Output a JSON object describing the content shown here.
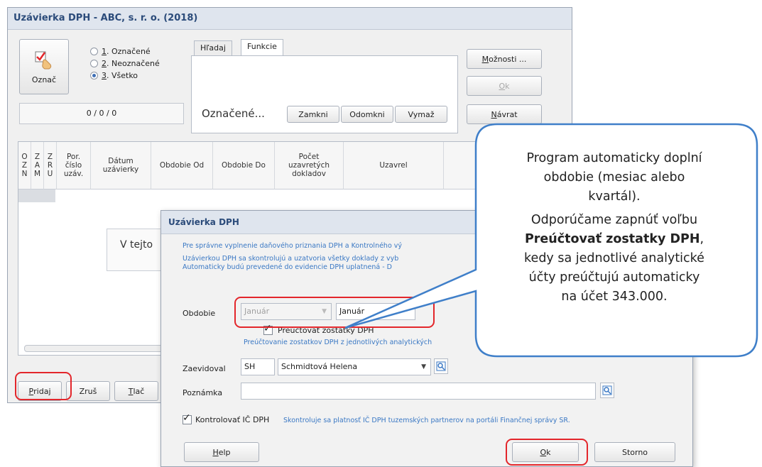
{
  "main": {
    "title": "Uzávierka DPH - ABC, s. r. o. (2018)",
    "mark_button": "Označ",
    "radios": [
      {
        "num": "1",
        "label": ". Označené"
      },
      {
        "num": "2",
        "label": ". Neoznačené"
      },
      {
        "num": "3",
        "label": ". Všetko"
      }
    ],
    "counter": "0 / 0 / 0",
    "tabs": [
      "Hľadaj",
      "Funkcie"
    ],
    "marked_label": "Označené...",
    "func_buttons": [
      "Zamkni",
      "Odomkni",
      "Vymaž"
    ],
    "side_buttons": {
      "options_u": "M",
      "options_rest": "ožnosti ...",
      "ok_u": "O",
      "ok_rest": "k",
      "return_u": "N",
      "return_rest": "ávrat"
    },
    "columns": [
      "O\nZ\nN",
      "Z\nA\nM",
      "Z\nR\nU",
      "Por.\nčíslo\nuzáv.",
      "Dátum\nuzávierky",
      "Obdobie Od",
      "Obdobie Do",
      "Počet\nuzavretých\ndokladov",
      "Uzavrel"
    ],
    "empty_text": "V tejto",
    "bottom_buttons": {
      "add_u": "P",
      "add_rest": "ridaj",
      "cancel_u": "",
      "cancel_rest": "Zruš",
      "print_u": "T",
      "print_rest": "lač"
    }
  },
  "dialog": {
    "title": "Uzávierka DPH",
    "info1": "Pre správne vyplnenie daňového priznania DPH a Kontrolného vý",
    "info2": "Uzávierkou DPH sa skontrolujú a uzatvoria všetky doklady z vyb",
    "info3": "Automaticky budú prevedené do evidencie DPH uplatnená - D",
    "period_label": "Obdobie",
    "period_from": "Január",
    "period_to": "Január",
    "rebook_label": "Preúčtovať zostatky DPH",
    "rebook_info": "Preúčtovanie zostatkov DPH z jednotlivých analytických",
    "recorded_label": "Zaevidoval",
    "recorded_code": "SH",
    "recorded_name": "Schmidtová Helena",
    "note_label": "Poznámka",
    "note_value": "",
    "check_vat_label": "Kontrolovať IČ DPH",
    "check_vat_info": "Skontroluje sa platnosť IČ DPH tuzemských partnerov na portáli Finančnej správy SR.",
    "help_u": "H",
    "help_rest": "elp",
    "ok_u": "O",
    "ok_rest": "k",
    "cancel": "Storno"
  },
  "callout": {
    "line1": "Program automaticky doplní",
    "line2": "obdobie (mesiac alebo",
    "line3": "kvartál).",
    "line4": "Odporúčame zapnúť voľbu",
    "line5_bold": "Preúčtovať zostatky DPH",
    "line5_rest": ",",
    "line6": "kedy sa jednotlivé analytické",
    "line7": "účty preúčtujú automaticky",
    "line8": "na účet 343.000."
  },
  "colors": {
    "accent": "#3a78c4",
    "highlight": "#e3262b",
    "callout_border": "#3f7fc9"
  }
}
